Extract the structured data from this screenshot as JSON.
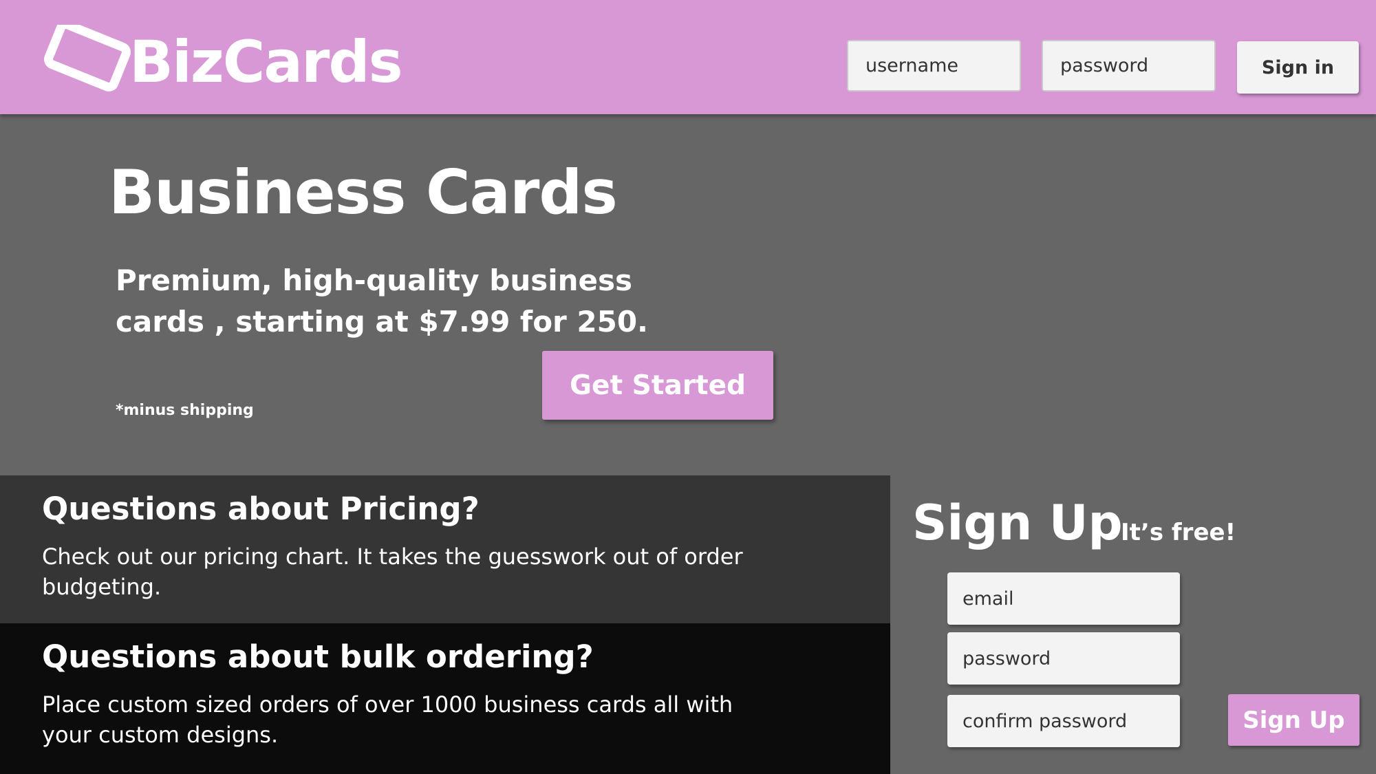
{
  "header": {
    "logo_text": "BizCards",
    "username_placeholder": "username",
    "password_placeholder": "password",
    "signin_label": "Sign in"
  },
  "hero": {
    "title": "Business Cards",
    "tagline": "Premium, high-quality business cards , starting at $7.99 for 250.",
    "note": "*minus shipping",
    "cta_label": "Get Started"
  },
  "faq": [
    {
      "title": "Questions about Pricing?",
      "body": "Check out our pricing chart. It takes the guesswork out of order budgeting."
    },
    {
      "title": "Questions about bulk ordering?",
      "body": "Place custom sized orders of over 1000 business cards all with your custom designs."
    }
  ],
  "signup": {
    "title": "Sign Up",
    "subtitle": "It’s free!",
    "email_placeholder": "email",
    "password_placeholder": "password",
    "confirm_placeholder": "confirm password",
    "button_label": "Sign Up"
  },
  "colors": {
    "brand": "#d898d6",
    "hero_bg": "#666666",
    "faq_pricing_bg": "#353535",
    "faq_bulk_bg": "#0c0c0c",
    "input_bg": "#f3f3f3"
  },
  "icons": {
    "logo": "card-icon"
  }
}
